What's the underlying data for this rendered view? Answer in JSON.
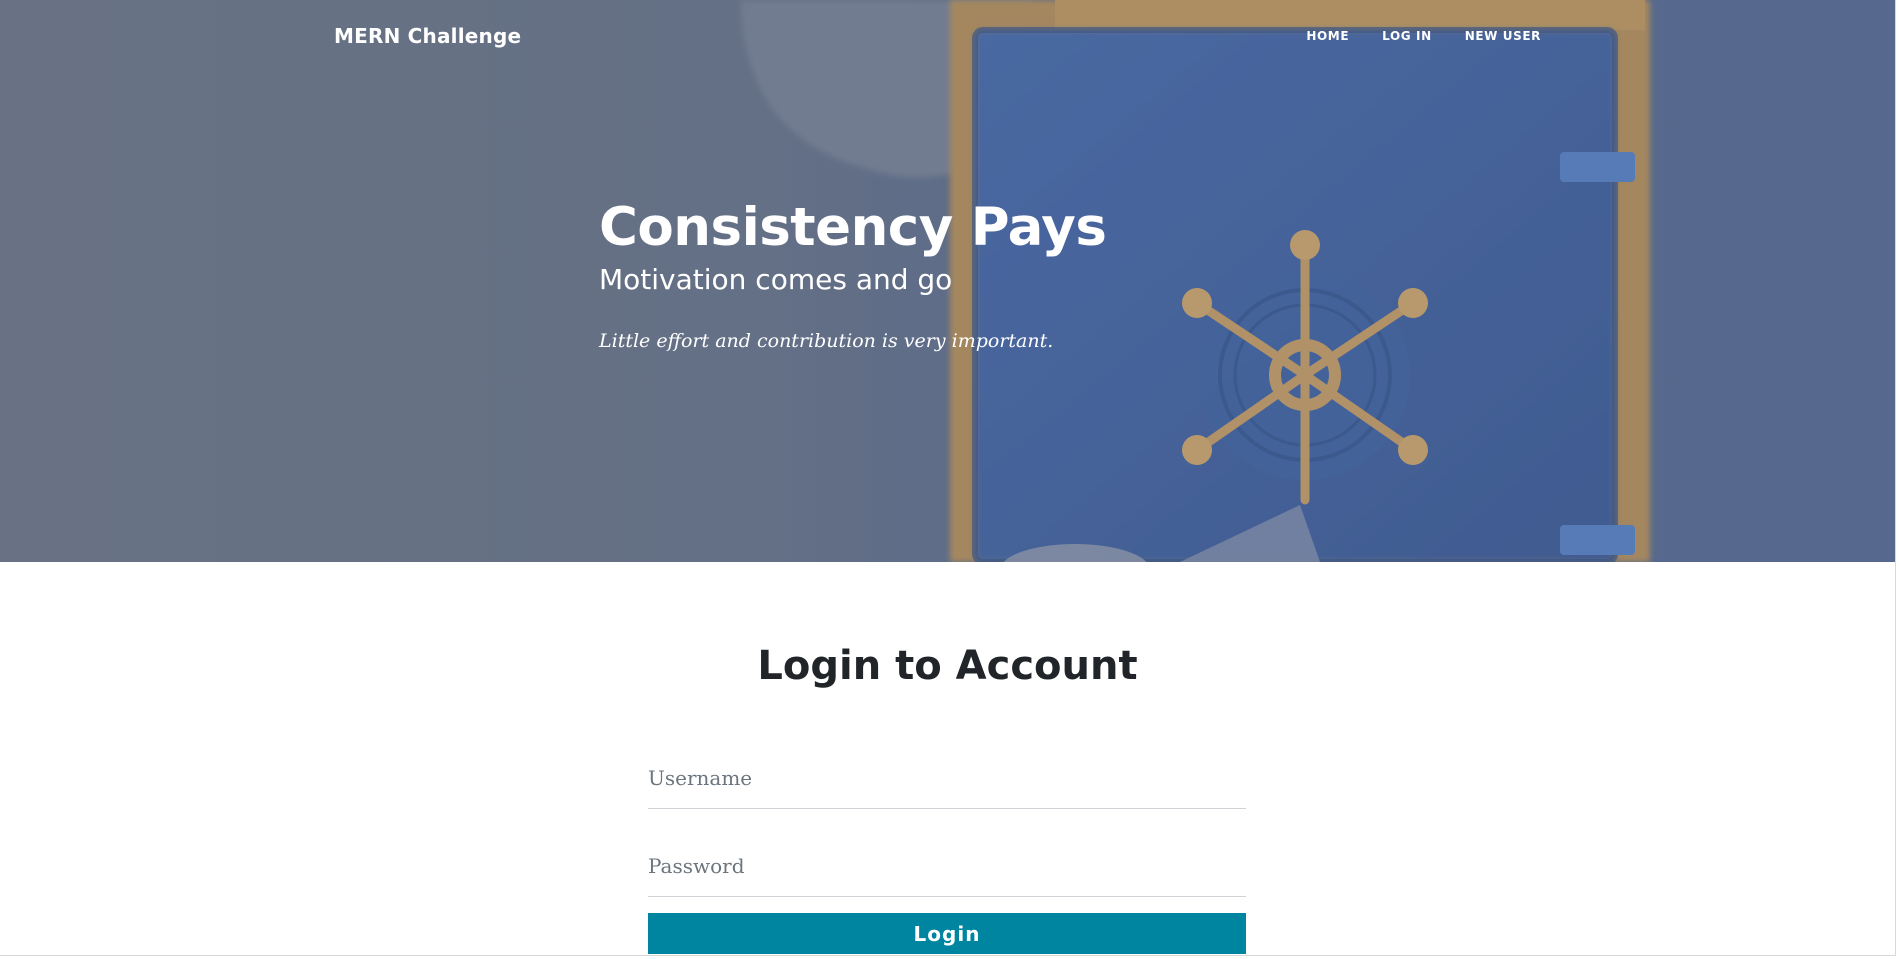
{
  "nav": {
    "brand": "MERN Challenge",
    "links": [
      "HOME",
      "LOG IN",
      "NEW USER"
    ]
  },
  "hero": {
    "title": "Consistency Pays",
    "subtitle": "Motivation comes and go",
    "tagline": "Little effort and contribution is very important."
  },
  "login": {
    "title": "Login to Account",
    "username_placeholder": "Username",
    "password_placeholder": "Password",
    "button_label": "Login"
  },
  "colors": {
    "accent": "#0085a1",
    "hero_overlay": "#6f7a8c",
    "text_dark": "#212529"
  }
}
